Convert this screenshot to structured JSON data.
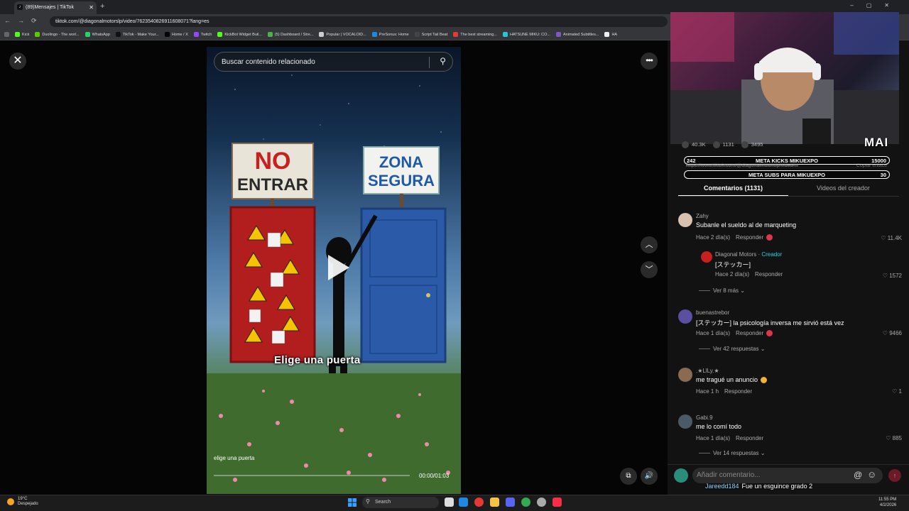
{
  "browser": {
    "tab_title": "(89)Mensajes | TikTok",
    "url": "tiktok.com/@diagonalmotorslp/video/7623540826911608071?lang=es",
    "bookmarks": [
      "Kick",
      "Duolingo - The worl...",
      "WhatsApp",
      "TikTok - Make Your...",
      "Home / X",
      "Twitch",
      "KickBot Widget Buil...",
      "(5) Dashboard / Stre...",
      "Popular | VOCALOID...",
      "PreSonus: Home",
      "Script Tail Beat",
      "The best streaming...",
      "HATSUNE MIKU: CO...",
      "Animated Subtitles...",
      "HA"
    ]
  },
  "video": {
    "search_placeholder": "Buscar contenido relacionado",
    "caption": "Elige una puerta",
    "description": "elige una puerta",
    "time": "00:00/01:03",
    "sign_left_1": "NO",
    "sign_left_2": "ENTRAR",
    "sign_right_1": "ZONA",
    "sign_right_2": "SEGURA",
    "progress": 0.0
  },
  "overlay": {
    "streamer_tag": "MAI",
    "stats": {
      "likes": "40.3K",
      "comments": "1131",
      "saves": "3495"
    },
    "meta1": {
      "left": "242",
      "label": "META KICKS MIKUEXPO",
      "right": "15000"
    },
    "meta2": {
      "left": "",
      "label": "META SUBS PARA MIKUEXPO",
      "right": "30"
    },
    "link_text": "https://www.tiktok.com/@diagonalmotorslp/video/...",
    "copy_link": "Copiar enlace",
    "chat_user": "Jareedd184",
    "chat_message": "Fue un esguince grado 2"
  },
  "tabs": {
    "comments": "Comentarios (1131)",
    "creator_videos": "Videos del creador"
  },
  "comments": [
    {
      "name": "Zahy",
      "text": "Subanle el sueldo al de marqueting",
      "time": "Hace 2 día(s)",
      "reply": "Responder",
      "likes": "11.4K"
    },
    {
      "name": "Diagonal Motors",
      "badge": "Creador",
      "text": "[ステッカー]",
      "time": "Hace 2 día(s)",
      "reply": "Responder",
      "likes": "1572"
    },
    {
      "name": "buenastrebor",
      "text": "[ステッカー] la psicología inversa me sirvió está vez",
      "time": "Hace 1 día(s)",
      "reply": "Responder",
      "likes": "9466"
    },
    {
      "name": ".★LlLy.★",
      "text": "me tragué un anuncio",
      "time": "Hace 1 h",
      "reply": "Responder",
      "likes": "1"
    },
    {
      "name": "Gabi.9",
      "text": "me lo comí todo",
      "time": "Hace 1 día(s)",
      "reply": "Responder",
      "likes": "885"
    }
  ],
  "more_replies": [
    "Ver 8 más",
    "Ver 42 respuestas",
    "Ver 14 respuestas"
  ],
  "comment_placeholder": "Añadir comentario...",
  "taskbar": {
    "temp": "19°C",
    "weather": "Despejado",
    "search": "Search",
    "time": "11:55 PM",
    "date": "4/2/2026"
  },
  "colors": {
    "accent": "#fe2c55",
    "creator": "#20d5ec",
    "panel": "#121212"
  }
}
